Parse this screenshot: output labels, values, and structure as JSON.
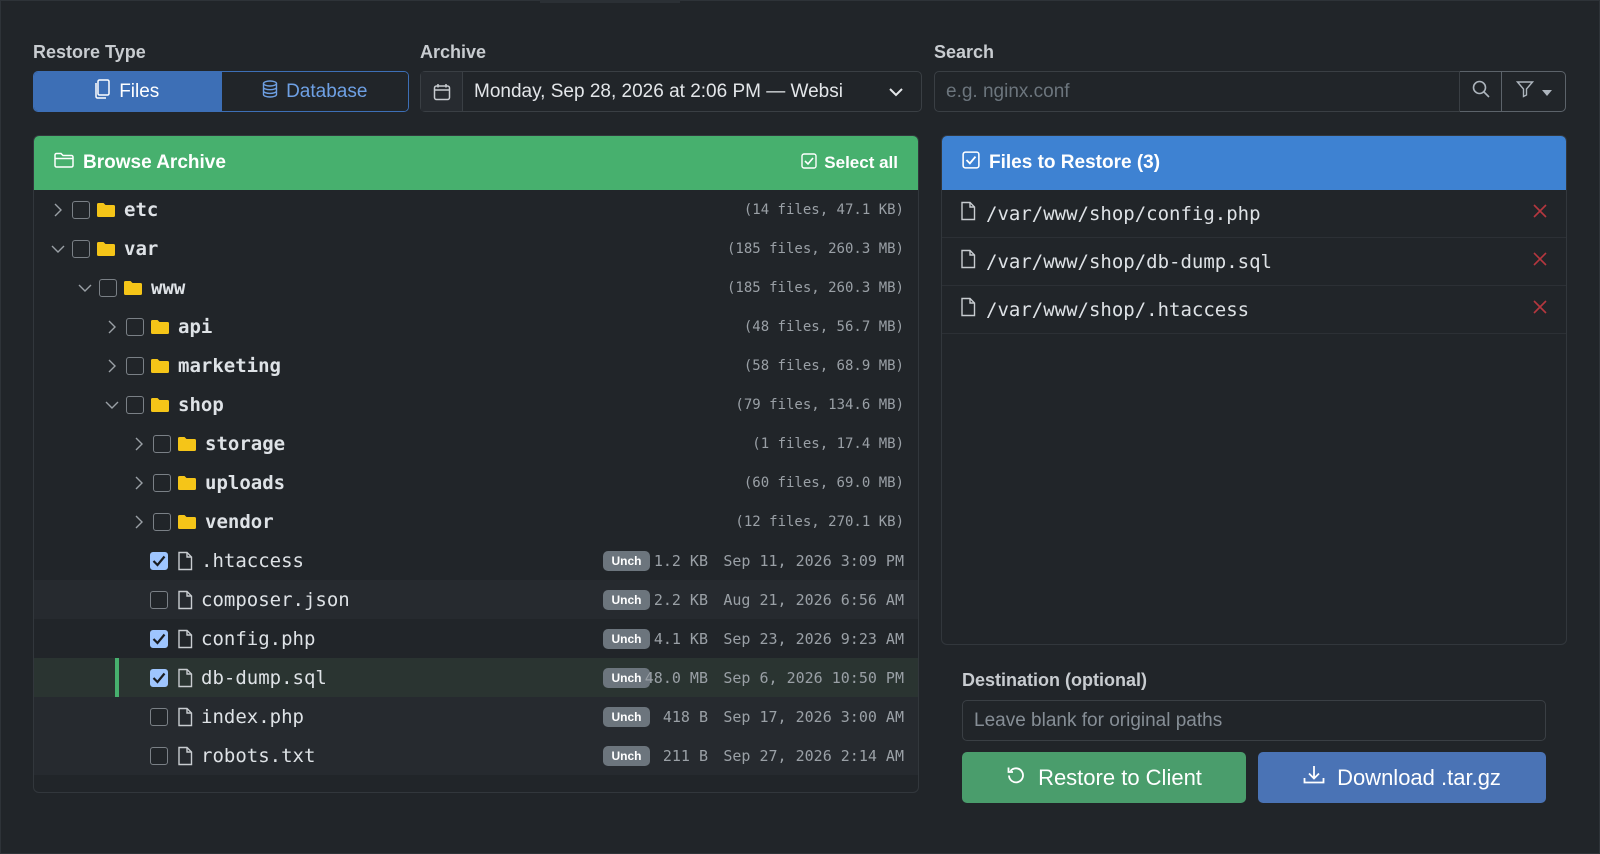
{
  "restore_type": {
    "label": "Restore Type",
    "options": [
      "Files",
      "Database"
    ],
    "selected": "Files"
  },
  "archive": {
    "label": "Archive",
    "value": "Monday, Sep 28, 2026 at 2:06 PM — Websi"
  },
  "search": {
    "label": "Search",
    "placeholder": "e.g. nginx.conf"
  },
  "browse": {
    "title": "Browse Archive",
    "select_all": "Select all",
    "folders": [
      {
        "name": "etc",
        "meta": "(14 files, 47.1 KB)"
      },
      {
        "name": "var",
        "meta": "(185 files, 260.3 MB)"
      },
      {
        "name": "www",
        "meta": "(185 files, 260.3 MB)"
      },
      {
        "name": "api",
        "meta": "(48 files, 56.7 MB)"
      },
      {
        "name": "marketing",
        "meta": "(58 files, 68.9 MB)"
      },
      {
        "name": "shop",
        "meta": "(79 files, 134.6 MB)"
      },
      {
        "name": "storage",
        "meta": "(1 files, 17.4 MB)"
      },
      {
        "name": "uploads",
        "meta": "(60 files, 69.0 MB)"
      },
      {
        "name": "vendor",
        "meta": "(12 files, 270.1 KB)"
      }
    ],
    "files": [
      {
        "name": ".htaccess",
        "badge": "Unch",
        "size": "1.2 KB",
        "date": "Sep 11, 2026 3:09 PM",
        "checked": true
      },
      {
        "name": "composer.json",
        "badge": "Unch",
        "size": "2.2 KB",
        "date": "Aug 21, 2026 6:56 AM",
        "checked": false
      },
      {
        "name": "config.php",
        "badge": "Unch",
        "size": "4.1 KB",
        "date": "Sep 23, 2026 9:23 AM",
        "checked": true
      },
      {
        "name": "db-dump.sql",
        "badge": "Unch",
        "size": "48.0 MB",
        "date": "Sep 6, 2026 10:50 PM",
        "checked": true
      },
      {
        "name": "index.php",
        "badge": "Unch",
        "size": "418 B",
        "date": "Sep 17, 2026 3:00 AM",
        "checked": false
      },
      {
        "name": "robots.txt",
        "badge": "Unch",
        "size": "211 B",
        "date": "Sep 27, 2026 2:14 AM",
        "checked": false
      }
    ]
  },
  "restore_list": {
    "title": "Files to Restore (3)",
    "items": [
      "/var/www/shop/config.php",
      "/var/www/shop/db-dump.sql",
      "/var/www/shop/.htaccess"
    ]
  },
  "destination": {
    "label": "Destination (optional)",
    "placeholder": "Leave blank for original paths"
  },
  "actions": {
    "restore": "Restore to Client",
    "download": "Download .tar.gz"
  },
  "colors": {
    "browse_header": "#47b06e",
    "restore_header": "#3e82d2",
    "folder": "#f5c518",
    "remove": "#b5373f"
  }
}
